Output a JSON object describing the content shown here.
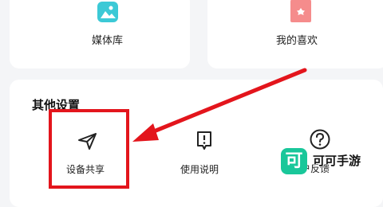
{
  "top_tiles": [
    {
      "label": "媒体库",
      "icon": "image-library-icon",
      "icon_color": "#3cc9d6"
    },
    {
      "label": "我的喜欢",
      "icon": "favorite-badge-icon",
      "icon_color": "#f58c8c"
    }
  ],
  "other_settings": {
    "title": "其他设置",
    "items": [
      {
        "label": "设备共享",
        "icon": "send-paper-plane-icon"
      },
      {
        "label": "使用说明",
        "icon": "manual-info-icon"
      },
      {
        "label": "户反馈",
        "icon": "question-circle-icon"
      }
    ]
  },
  "annotation": {
    "highlight_color": "#e3151c",
    "arrow_color": "#e3151c"
  },
  "watermark": {
    "logo_char": "可",
    "text": "可可手游",
    "color": "#19c79a"
  }
}
